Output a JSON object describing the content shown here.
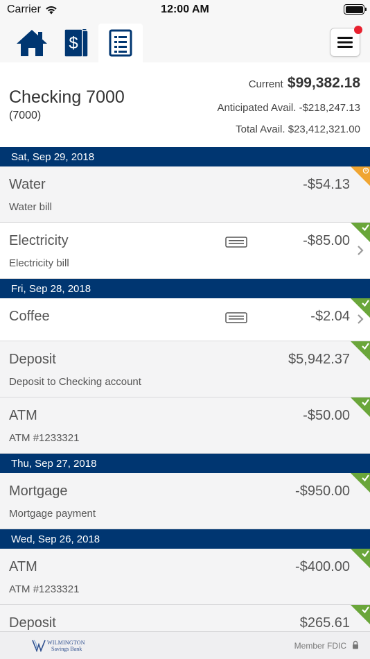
{
  "status_bar": {
    "carrier": "Carrier",
    "time": "12:00 AM"
  },
  "nav": {
    "tabs": [
      {
        "name": "home",
        "icon": "home-icon"
      },
      {
        "name": "transfers",
        "icon": "dollar-cards-icon"
      },
      {
        "name": "transactions",
        "icon": "document-list-icon",
        "active": true
      }
    ],
    "menu_icon": "hamburger-menu-icon",
    "has_notification": true
  },
  "account": {
    "name": "Checking 7000",
    "number": "(7000)",
    "current_label": "Current",
    "current_amount": "$99,382.18",
    "anticipated": "Anticipated Avail. -$218,247.13",
    "total": "Total Avail. $23,412,321.00"
  },
  "groups": [
    {
      "date": "Sat, Sep 29, 2018",
      "transactions": [
        {
          "name": "Water",
          "memo": "Water bill",
          "amount": "-$54.13",
          "status": "pending"
        },
        {
          "name": "Electricity",
          "memo": "Electricity bill",
          "amount": "-$85.00",
          "status": "cleared"
        }
      ]
    },
    {
      "date": "Fri, Sep 28, 2018",
      "transactions": [
        {
          "name": "Coffee",
          "memo": "",
          "amount": "-$2.04",
          "status": "cleared"
        },
        {
          "name": "Deposit",
          "memo": "Deposit to Checking account",
          "amount": "$5,942.37",
          "status": "cleared"
        },
        {
          "name": "ATM",
          "memo": "ATM #1233321",
          "amount": "-$50.00",
          "status": "cleared"
        }
      ]
    },
    {
      "date": "Thu, Sep 27, 2018",
      "transactions": [
        {
          "name": "Mortgage",
          "memo": "Mortgage payment",
          "amount": "-$950.00",
          "status": "cleared"
        }
      ]
    },
    {
      "date": "Wed, Sep 26, 2018",
      "transactions": [
        {
          "name": "ATM",
          "memo": "ATM #1233321",
          "amount": "-$400.00",
          "status": "cleared"
        },
        {
          "name": "Deposit",
          "memo": "",
          "amount": "$265.61",
          "status": "cleared"
        }
      ]
    }
  ],
  "footer": {
    "logo_line1": "WILMINGTON",
    "logo_line2": "Savings Bank",
    "fdic": "Member FDIC"
  },
  "colors": {
    "navy": "#003671",
    "cleared_green": "#6aa63a",
    "pending_orange": "#f0a531",
    "notification_red": "#e8212f"
  }
}
